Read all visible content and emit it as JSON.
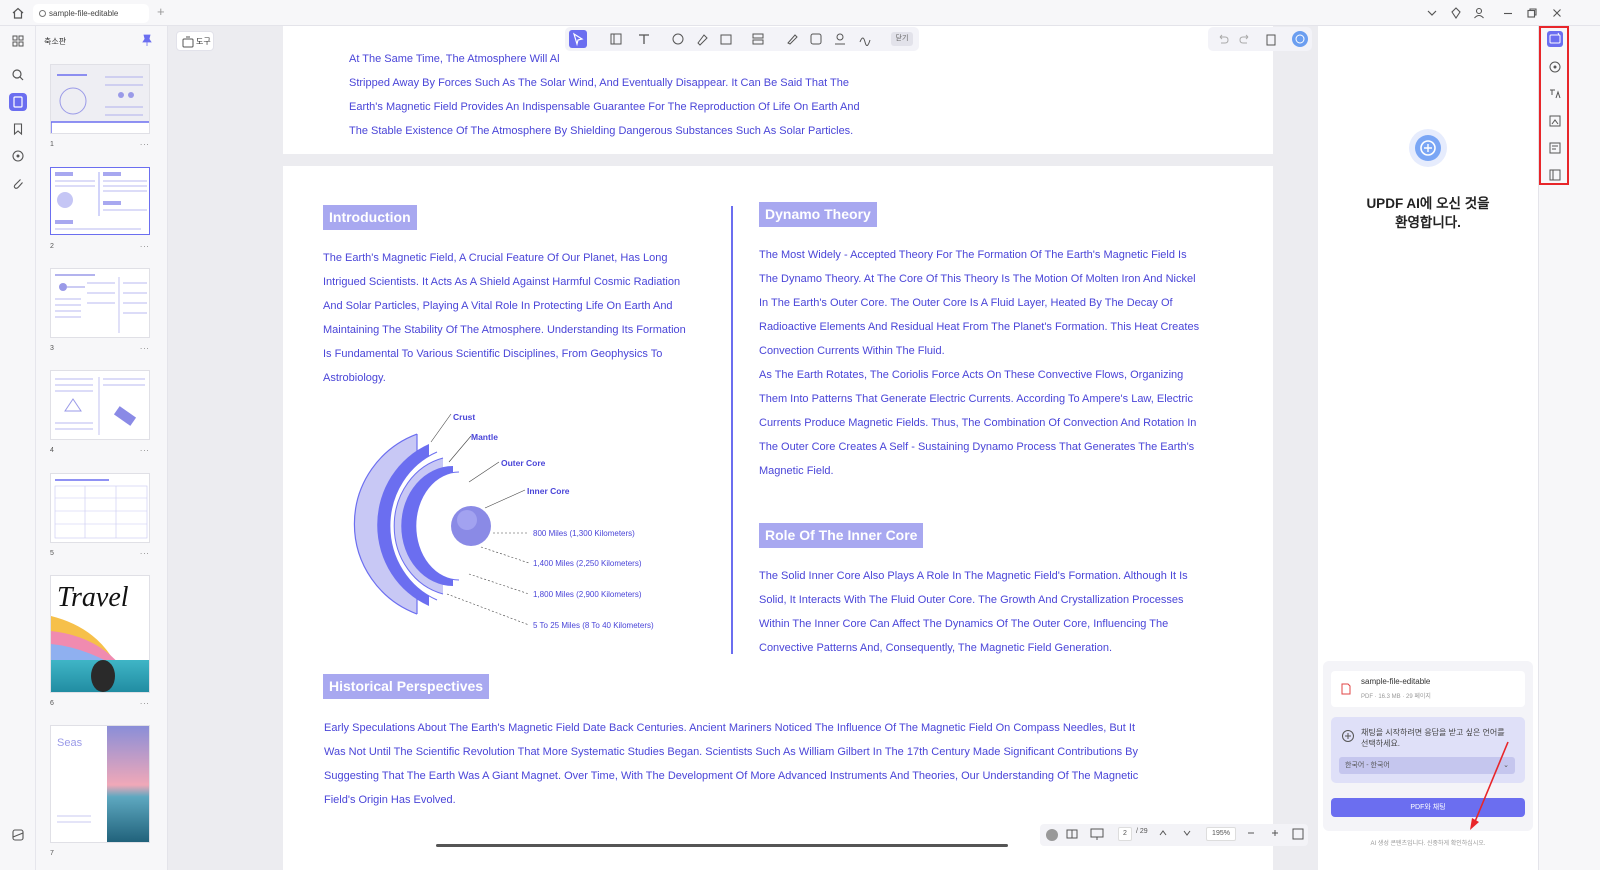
{
  "titlebar": {
    "tab_label": "sample-file-editable",
    "add_tab": "+"
  },
  "thumbs": {
    "title": "축소판",
    "more": "...",
    "pages": [
      {
        "num": "1"
      },
      {
        "num": "2"
      },
      {
        "num": "3"
      },
      {
        "num": "4"
      },
      {
        "num": "5"
      },
      {
        "num": "6"
      },
      {
        "num": "7"
      }
    ],
    "thumb6_title": "Travel",
    "thumb7_title": "Seas"
  },
  "toolbar": {
    "tool_label": "도구",
    "close_label": "닫기"
  },
  "page1": {
    "lines": [
      "At The Same Time, The Atmosphere Will Al",
      "Stripped Away By Forces Such As The Solar Wind, And Eventually Disappear. It Can Be Said That The",
      "Earth's Magnetic Field Provides An Indispensable Guarantee For The Reproduction Of Life On Earth And",
      "The Stable Existence Of The Atmosphere By Shielding Dangerous Substances Such As Solar Particles."
    ]
  },
  "page2": {
    "intro_heading": "Introduction",
    "intro_lines": [
      "The Earth's Magnetic Field, A Crucial Feature Of Our Planet, Has Long",
      "Intrigued Scientists. It Acts As A Shield Against Harmful Cosmic Radiation",
      "And Solar Particles, Playing A Vital Role In Protecting Life On Earth And",
      "Maintaining The Stability Of The Atmosphere. Understanding Its Formation",
      "Is Fundamental To Various Scientific Disciplines, From Geophysics To",
      "Astrobiology."
    ],
    "diagram": {
      "crust": "Crust",
      "mantle": "Mantle",
      "outer_core": "Outer Core",
      "inner_core": "Inner Core",
      "d1": "800 Miles (1,300 Kilometers)",
      "d2": "1,400 Miles (2,250 Kilometers)",
      "d3": "1,800 Miles (2,900 Kilometers)",
      "d4": "5 To 25 Miles (8 To 40 Kilometers)"
    },
    "dynamo_heading": "Dynamo Theory",
    "dynamo_lines": [
      "The Most Widely - Accepted Theory For The Formation Of The Earth's Magnetic Field Is",
      "The Dynamo Theory. At The Core Of This Theory Is The Motion Of Molten Iron And Nickel",
      "In The Earth's Outer Core. The Outer Core Is A Fluid Layer, Heated By The Decay Of",
      "Radioactive Elements And Residual Heat From The Planet's Formation. This Heat Creates",
      "Convection Currents Within The Fluid.",
      "As The Earth Rotates, The Coriolis Force Acts On These Convective Flows, Organizing",
      "Them Into Patterns That Generate Electric Currents. According To Ampere's Law, Electric",
      "Currents Produce Magnetic Fields. Thus, The Combination Of Convection And Rotation In",
      "The Outer Core Creates A Self - Sustaining Dynamo Process That Generates The Earth's",
      "Magnetic Field."
    ],
    "inner_heading": "Role Of The Inner Core",
    "inner_lines": [
      "The Solid Inner Core Also Plays A Role In The Magnetic Field's Formation. Although It Is",
      "Solid, It Interacts With The Fluid Outer Core. The Growth And Crystallization Processes",
      "Within The Inner Core Can Affect The Dynamics Of The Outer Core, Influencing The",
      "Convective Patterns And, Consequently, The Magnetic Field Generation."
    ],
    "hist_heading": "Historical Perspectives",
    "hist_lines": [
      "Early Speculations About The Earth's Magnetic Field Date Back Centuries. Ancient Mariners Noticed The Influence Of The Magnetic Field On Compass Needles, But It",
      "Was Not Until The Scientific Revolution That More Systematic Studies Began. Scientists Such As William Gilbert In The 17th Century Made Significant Contributions By",
      "Suggesting That The Earth Was A Giant Magnet. Over Time, With The Development Of More Advanced Instruments And Theories, Our Understanding Of The Magnetic",
      "Field's Origin Has Evolved."
    ]
  },
  "status": {
    "page": "2",
    "total": "/ 29",
    "zoom": "195%"
  },
  "ai": {
    "welcome_line1": "UPDF AI에 오신 것을",
    "welcome_line2": "환영합니다.",
    "file_name": "sample-file-editable",
    "file_meta": "PDF · 16.3 MB · 29 페이지",
    "lang_prompt": "채팅을 시작하려면 응답을 받고 싶은 언어를 선택하세요.",
    "lang_value": "한국어 - 한국어",
    "chat_button": "PDF와 채팅",
    "footer": "AI 생성 콘텐츠입니다. 신중하게 확인하십시오."
  },
  "colors": {
    "accent": "#6b6ef0",
    "text_blue": "#4a45d8",
    "heading_bg": "#a8a8f0",
    "highlight_red": "#e8262a"
  }
}
